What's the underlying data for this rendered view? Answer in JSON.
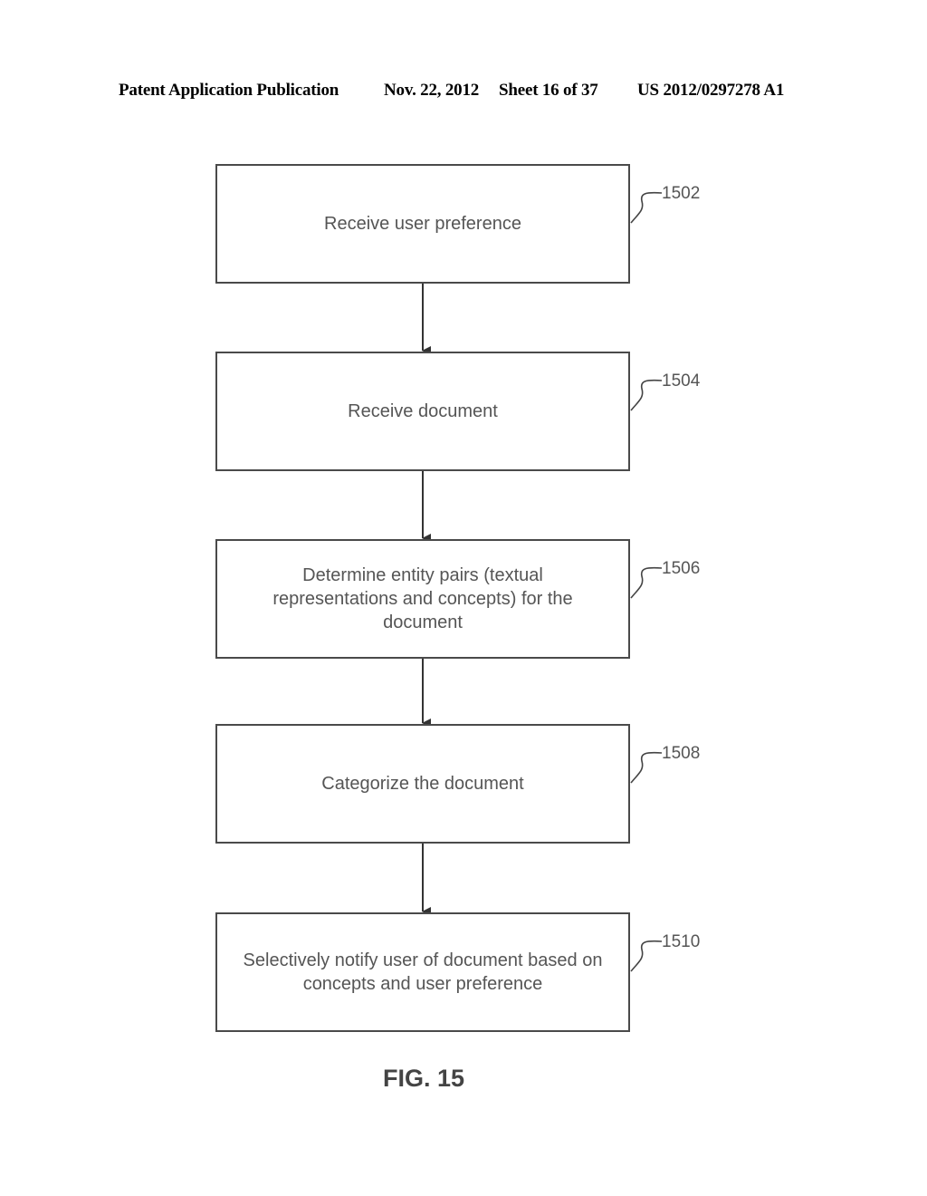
{
  "header": {
    "publication": "Patent Application Publication",
    "date": "Nov. 22, 2012",
    "sheet": "Sheet 16 of 37",
    "number": "US 2012/0297278 A1"
  },
  "steps": [
    {
      "ref": "1502",
      "text": "Receive user preference"
    },
    {
      "ref": "1504",
      "text": "Receive document"
    },
    {
      "ref": "1506",
      "text": "Determine entity pairs (textual representations and concepts) for the document"
    },
    {
      "ref": "1508",
      "text": "Categorize the document"
    },
    {
      "ref": "1510",
      "text": "Selectively notify user of document based on concepts and user preference"
    }
  ],
  "figure_label": "FIG. 15"
}
